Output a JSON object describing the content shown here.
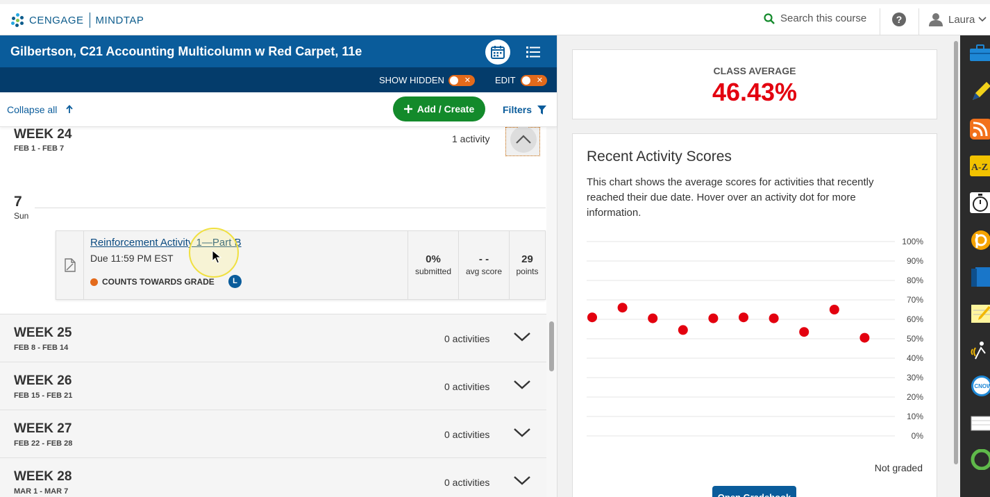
{
  "brand": {
    "cengage": "CENGAGE",
    "mindtap": "MINDTAP"
  },
  "topbar": {
    "search_placeholder": "Search this course",
    "help": "?",
    "user": "Laura"
  },
  "course": {
    "title": "Gilbertson, C21 Accounting Multicolumn w Red Carpet, 11e",
    "show_hidden_label": "SHOW HIDDEN",
    "edit_label": "EDIT",
    "toggle_off_symbol": "✕"
  },
  "actions": {
    "collapse_all": "Collapse all",
    "add_create": "Add / Create",
    "filters": "Filters"
  },
  "week24": {
    "title": "WEEK 24",
    "range": "FEB 1 - FEB 7",
    "count": "1 activity",
    "day_number": "7",
    "day_name": "Sun",
    "activity": {
      "title": "Reinforcement Activity 1—Part B",
      "due": "Due 11:59 PM EST",
      "counts_label": "COUNTS TOWARDS GRADE",
      "badge": "L",
      "submitted_value": "0%",
      "submitted_label": "submitted",
      "avg_value": "- -",
      "avg_label": "avg score",
      "points_value": "29",
      "points_label": "points"
    }
  },
  "weeks": [
    {
      "title": "WEEK 25",
      "range": "FEB 8 - FEB 14",
      "count": "0 activities"
    },
    {
      "title": "WEEK 26",
      "range": "FEB 15 - FEB 21",
      "count": "0 activities"
    },
    {
      "title": "WEEK 27",
      "range": "FEB 22 - FEB 28",
      "count": "0 activities"
    },
    {
      "title": "WEEK 28",
      "range": "MAR 1 - MAR 7",
      "count": "0 activities"
    }
  ],
  "class_average": {
    "label": "CLASS AVERAGE",
    "value": "46.43%"
  },
  "recent": {
    "title": "Recent Activity Scores",
    "description": "This chart shows the average scores for activities that recently reached their due date. Hover over an activity dot for more information.",
    "not_graded": "Not graded",
    "open_gradebook": "Open Gradebook"
  },
  "chart_data": {
    "type": "scatter",
    "y_ticks": [
      "100%",
      "90%",
      "80%",
      "70%",
      "60%",
      "50%",
      "40%",
      "30%",
      "20%",
      "10%",
      "0%"
    ],
    "ylim": [
      0,
      100
    ],
    "grid": true,
    "values": [
      61,
      66,
      60.5,
      54.5,
      60.5,
      61,
      60.5,
      53.5,
      65,
      50.5
    ],
    "point_color": "#e3000f"
  },
  "colors": {
    "brand_blue": "#0a5c9b",
    "navy": "#043c6b",
    "green": "#138a2b",
    "orange": "#e36a1b",
    "red": "#e3000f"
  },
  "dock": [
    "briefcase-icon",
    "highlighter-icon",
    "rss-icon",
    "dictionary-icon",
    "stopwatch-icon",
    "bookmark-b-icon",
    "book-icon",
    "notepad-icon",
    "read-aloud-icon",
    "cnow-icon",
    "flashcards-icon",
    "green-ring-icon"
  ]
}
